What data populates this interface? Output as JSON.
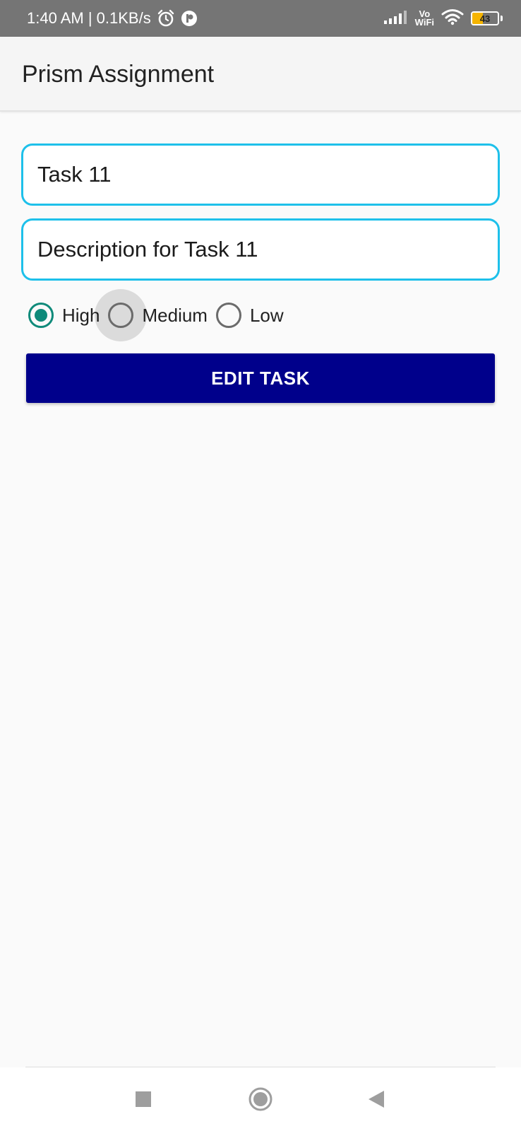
{
  "status_bar": {
    "time_speed": "1:40 AM | 0.1KB/s",
    "vowifi_top": "Vo",
    "vowifi_bottom": "WiFi",
    "battery": "43",
    "icons": [
      "alarm-icon",
      "app-notification-icon",
      "signal-icon",
      "wifi-icon",
      "battery-icon"
    ]
  },
  "app_bar": {
    "title": "Prism Assignment"
  },
  "form": {
    "title_field": {
      "value": "Task 11",
      "placeholder": ""
    },
    "description_field": {
      "value": "Description for Task 11",
      "placeholder": ""
    },
    "priority": {
      "options": [
        {
          "label": "High",
          "checked": true
        },
        {
          "label": "Medium",
          "checked": false,
          "pressed": true
        },
        {
          "label": "Low",
          "checked": false
        }
      ]
    },
    "submit_label": "EDIT TASK"
  },
  "nav_bar": {
    "buttons": [
      "recents-icon",
      "home-icon",
      "back-icon"
    ]
  },
  "colors": {
    "status_bar": "#757575",
    "field_border": "#1ec0ea",
    "radio_checked": "#0f8a7a",
    "button": "#00008b"
  }
}
